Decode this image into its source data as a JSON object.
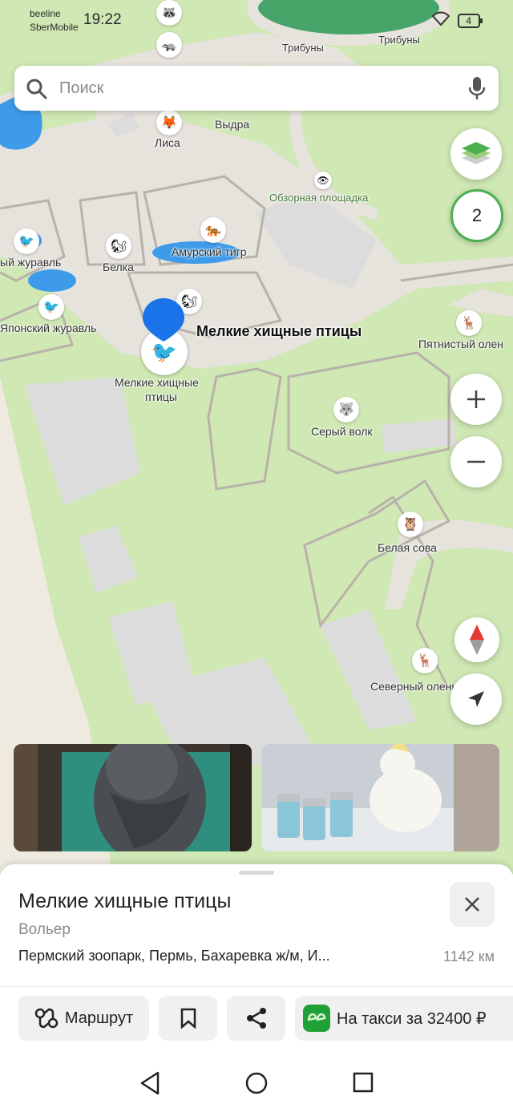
{
  "status": {
    "operator_1": "beeline",
    "operator_2": "SberMobile",
    "time": "19:22",
    "battery": "4"
  },
  "search": {
    "placeholder": "Поиск"
  },
  "layers_count": "2",
  "map_labels": {
    "tribuny_1": "Трибуны",
    "tribuny_2": "Трибуны",
    "vydra": "Выдра",
    "lisa": "Лиса",
    "obzornaya": "Обзорная площадка",
    "zhuravl_1": "ый журавль",
    "belka": "Белка",
    "amur_tiger": "Амурский тигр",
    "japan_crane": "Японский журавль",
    "selected_name": "Мелкие хищные птицы",
    "selected_pin_line1": "Мелкие хищные",
    "selected_pin_line2": "птицы",
    "spotted_deer": "Пятнистый олен",
    "grey_wolf": "Серый волк",
    "snowy_owl": "Белая сова",
    "reindeer": "Северный олень"
  },
  "place": {
    "title": "Мелкие хищные птицы",
    "category": "Вольер",
    "address": "Пермский зоопарк, Пермь, Бахаревка ж/м, И...",
    "distance": "1142 км"
  },
  "actions": {
    "route": "Маршрут",
    "taxi": "На такси за 32400 ₽"
  },
  "colors": {
    "map_green": "#cfe8b4",
    "path_gray": "#e6e2dc",
    "water": "#3d9be9",
    "pin_blue": "#1a73e8",
    "taxi_green": "#21a038"
  }
}
